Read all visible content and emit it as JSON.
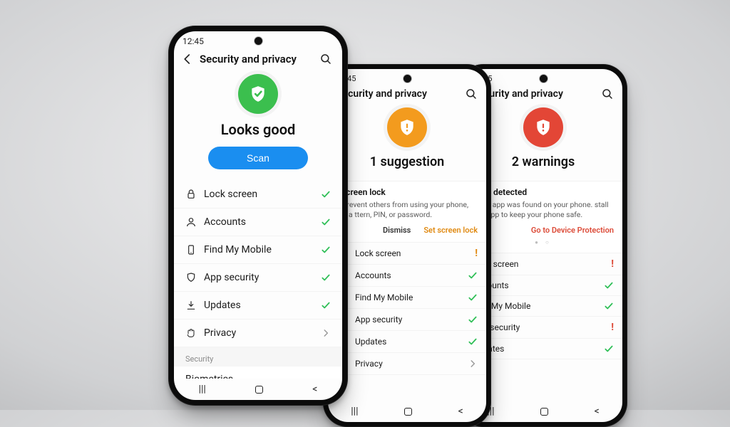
{
  "common": {
    "time": "12:45",
    "page_title": "Security and privacy",
    "list": {
      "lock_screen": "Lock screen",
      "accounts": "Accounts",
      "find_my_mobile": "Find My Mobile",
      "app_security": "App security",
      "updates": "Updates",
      "privacy": "Privacy"
    }
  },
  "front": {
    "status_headline": "Looks good",
    "scan_label": "Scan",
    "section_label": "Security",
    "biometrics_label": "Biometrics",
    "states": {
      "lock_screen": "check",
      "accounts": "check",
      "find_my_mobile": "check",
      "app_security": "check",
      "updates": "check",
      "privacy": "chevron"
    }
  },
  "mid": {
    "status_headline": "1 suggestion",
    "card": {
      "title_visible": "t screen lock",
      "desc_visible": "p prevent others from using your phone, set a ttern, PIN, or password.",
      "dismiss": "Dismiss",
      "primary": "Set screen lock"
    },
    "states": {
      "lock_screen": "bang",
      "accounts": "check",
      "find_my_mobile": "check",
      "app_security": "check",
      "updates": "check",
      "privacy": "chevron"
    }
  },
  "back": {
    "status_headline": "2 warnings",
    "card": {
      "title_visible": "ware detected",
      "desc_visible": "lware app was found on your phone. stall this app to keep your phone safe.",
      "primary": "Go to Device Protection"
    },
    "states": {
      "lock_screen": "bang-red",
      "accounts": "check",
      "find_my_mobile": "check",
      "app_security": "bang-red",
      "updates": "check"
    }
  }
}
